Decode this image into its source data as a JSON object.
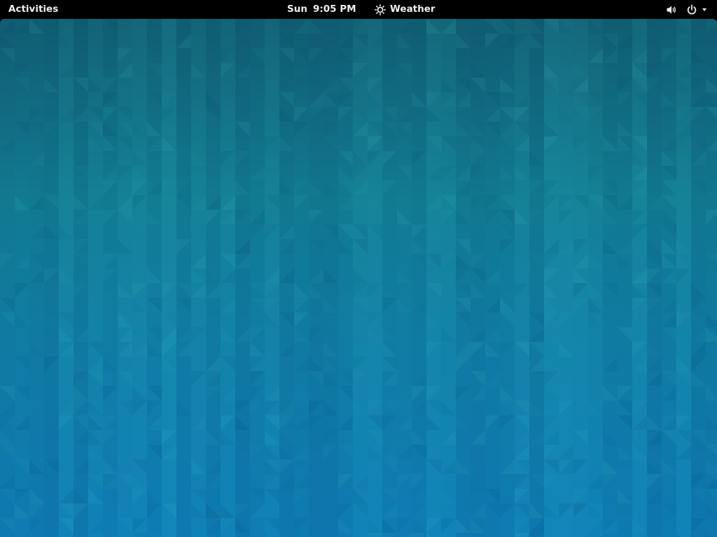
{
  "topbar": {
    "activities_label": "Activities",
    "clock": {
      "day": "Sun",
      "time": "9:05 PM"
    },
    "weather_label": "Weather",
    "icons": {
      "weather": "sun-icon",
      "volume": "volume-icon",
      "power": "power-icon",
      "menu_arrow": "chevron-down-icon"
    }
  },
  "colors": {
    "topbar_bg": "#000000",
    "topbar_text": "#eeeeec",
    "wallpaper_top": "#125f72",
    "wallpaper_bottom": "#0f7fb8"
  }
}
